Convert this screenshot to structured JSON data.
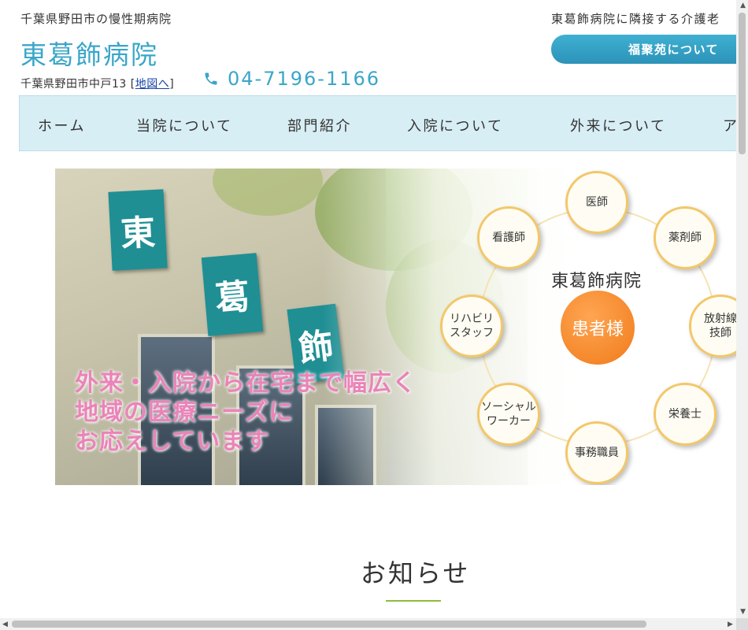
{
  "header": {
    "tagline": "千葉県野田市の慢性期病院",
    "logo": "東葛飾病院",
    "address_prefix": "千葉県野田市中戸13",
    "address_link": "地図へ",
    "bracket_open": "[",
    "bracket_close": "]",
    "phone": "04-7196-1166",
    "neighbor_text": "東葛飾病院に隣接する介護老",
    "fukuju_button": "福聚苑について"
  },
  "nav": {
    "items": [
      {
        "label": "ホーム"
      },
      {
        "label": "当院について"
      },
      {
        "label": "部門紹介"
      },
      {
        "label": "入院について"
      },
      {
        "label": "外来について"
      },
      {
        "label": "ア"
      }
    ]
  },
  "hero": {
    "signs": [
      "東",
      "葛",
      "飾"
    ],
    "copy_lines": [
      "外来・入院から在宅まで幅広く",
      "地域の医療ニーズに",
      "お応えしています"
    ],
    "diagram": {
      "center_label": "東葛飾病院",
      "patient": "患者様",
      "roles": [
        "医師",
        "薬剤師",
        "放射線\n技師",
        "栄養士",
        "事務職員",
        "ソーシャル\nワーカー",
        "リハビリ\nスタッフ",
        "看護師"
      ]
    }
  },
  "news": {
    "title": "お知らせ"
  },
  "colors": {
    "accent": "#3aa6c8",
    "nav_bg": "#d8eef5",
    "hero_text": "#ea84b8",
    "patient": "#f07b1a",
    "underline": "#8ebd3c"
  },
  "icons": {
    "phone": "phone-icon"
  }
}
